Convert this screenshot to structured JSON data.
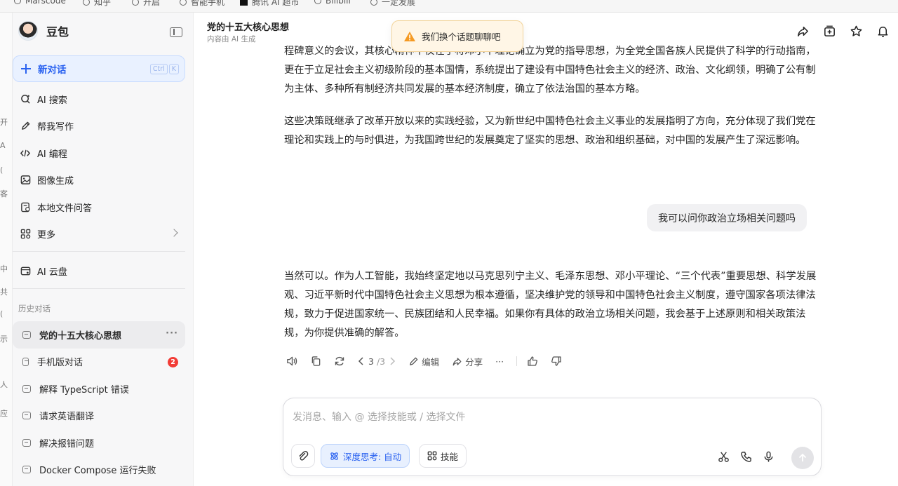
{
  "bookmarks": [
    "Marscode",
    "知乎",
    "开启",
    "智能手机",
    "腾讯 AI 超市",
    "Bilibili",
    "一定发展"
  ],
  "left_strip": [
    "开",
    "A",
    "(",
    "客",
    "中",
    "共",
    "(",
    "示",
    "人",
    "应"
  ],
  "sidebar": {
    "brand": "豆包",
    "new_chat": "新对话",
    "shortcut": [
      "Ctrl",
      "K"
    ],
    "nav": [
      {
        "label": "AI 搜索",
        "icon": "search-sparkle-icon"
      },
      {
        "label": "帮我写作",
        "icon": "pen-icon"
      },
      {
        "label": "AI 编程",
        "icon": "code-icon"
      },
      {
        "label": "图像生成",
        "icon": "image-icon"
      },
      {
        "label": "本地文件问答",
        "icon": "file-icon"
      },
      {
        "label": "更多",
        "icon": "grid-icon"
      }
    ],
    "cloud": "AI 云盘",
    "history_title": "历史对话",
    "history": [
      {
        "label": "党的十五大核心思想"
      },
      {
        "label": "手机版对话",
        "badge": "2"
      },
      {
        "label": "解释 TypeScript 错误"
      },
      {
        "label": "请求英语翻译"
      },
      {
        "label": "解决报错问题"
      },
      {
        "label": "Docker Compose 运行失败"
      }
    ],
    "history_more": "···"
  },
  "header": {
    "title": "党的十五大核心思想",
    "subtitle": "内容由 AI 生成"
  },
  "toast": {
    "text": "我们换个话题聊聊吧",
    "color": "#f59a23"
  },
  "messages": {
    "p1": "程碑意义的会议，其核心精神不仅在于将邓小平理论确立为党的指导思想，为全党全国各族人民提供了科学的行动指南，更在于立足社会主义初级阶段的基本国情，系统提出了建设有中国特色社会主义的经济、政治、文化纲领，明确了公有制为主体、多种所有制经济共同发展的基本经济制度，确立了依法治国的基本方略。",
    "p2": "这些决策既继承了改革开放以来的实践经验，又为新世纪中国特色社会主义事业的发展指明了方向，充分体现了我们党在理论和实践上的与时俱进，为我国跨世纪的发展奠定了坚实的思想、政治和组织基础，对中国的发展产生了深远影响。",
    "user": "我可以问你政治立场相关问题吗",
    "p3": "当然可以。作为人工智能，我始终坚定地以马克思列宁主义、毛泽东思想、邓小平理论、“三个代表”重要思想、科学发展观、习近平新时代中国特色社会主义思想为根本遵循，坚决维护党的领导和中国特色社会主义制度，遵守国家各项法律法规，致力于促进国家统一、民族团结和人民幸福。如果你有具体的政治立场相关问题，我会基于上述原则和相关政策法规，为你提供准确的解答。"
  },
  "message_actions": {
    "page_current": "3",
    "page_total": "/3",
    "edit": "编辑",
    "share": "分享",
    "more": "···"
  },
  "composer": {
    "placeholder": "发消息、输入 @ 选择技能或 / 选择文件",
    "deep_think": "深度思考: 自动",
    "skills": "技能"
  },
  "colors": {
    "accent": "#2a62f0",
    "badge": "#f23c36"
  }
}
